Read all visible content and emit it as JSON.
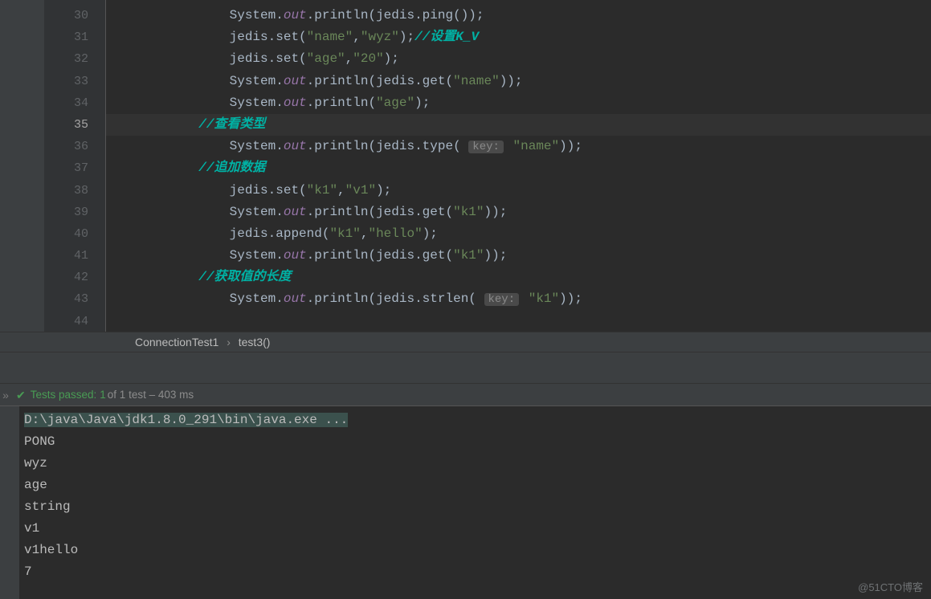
{
  "editor": {
    "lineStart": 30,
    "currentLine": 35,
    "lines": [
      {
        "indent": 16,
        "tokens": [
          {
            "t": "System.",
            "c": "p"
          },
          {
            "t": "out",
            "c": "f"
          },
          {
            "t": ".println(jedis.ping());",
            "c": "p"
          }
        ]
      },
      {
        "indent": 16,
        "tokens": [
          {
            "t": "jedis.set(",
            "c": "p"
          },
          {
            "t": "\"name\"",
            "c": "s"
          },
          {
            "t": ",",
            "c": "p"
          },
          {
            "t": "\"wyz\"",
            "c": "s"
          },
          {
            "t": ");",
            "c": "p"
          },
          {
            "t": "//设置K_V",
            "c": "c"
          }
        ]
      },
      {
        "indent": 16,
        "tokens": [
          {
            "t": "jedis.set(",
            "c": "p"
          },
          {
            "t": "\"age\"",
            "c": "s"
          },
          {
            "t": ",",
            "c": "p"
          },
          {
            "t": "\"20\"",
            "c": "s"
          },
          {
            "t": ");",
            "c": "p"
          }
        ]
      },
      {
        "indent": 16,
        "tokens": [
          {
            "t": "System.",
            "c": "p"
          },
          {
            "t": "out",
            "c": "f"
          },
          {
            "t": ".println(jedis.get(",
            "c": "p"
          },
          {
            "t": "\"name\"",
            "c": "s"
          },
          {
            "t": "));",
            "c": "p"
          }
        ]
      },
      {
        "indent": 16,
        "tokens": [
          {
            "t": "System.",
            "c": "p"
          },
          {
            "t": "out",
            "c": "f"
          },
          {
            "t": ".println(",
            "c": "p"
          },
          {
            "t": "\"age\"",
            "c": "s"
          },
          {
            "t": ");",
            "c": "p"
          }
        ]
      },
      {
        "indent": 12,
        "tokens": [
          {
            "t": "//查看类型",
            "c": "c"
          }
        ]
      },
      {
        "indent": 16,
        "tokens": [
          {
            "t": "System.",
            "c": "p"
          },
          {
            "t": "out",
            "c": "f"
          },
          {
            "t": ".println(jedis.type( ",
            "c": "p"
          },
          {
            "t": "key:",
            "c": "hint"
          },
          {
            "t": " ",
            "c": "p"
          },
          {
            "t": "\"name\"",
            "c": "s"
          },
          {
            "t": "));",
            "c": "p"
          }
        ]
      },
      {
        "indent": 12,
        "tokens": [
          {
            "t": "//追加数据",
            "c": "c"
          }
        ]
      },
      {
        "indent": 16,
        "tokens": [
          {
            "t": "jedis.set(",
            "c": "p"
          },
          {
            "t": "\"k1\"",
            "c": "s"
          },
          {
            "t": ",",
            "c": "p"
          },
          {
            "t": "\"v1\"",
            "c": "s"
          },
          {
            "t": ");",
            "c": "p"
          }
        ]
      },
      {
        "indent": 16,
        "tokens": [
          {
            "t": "System.",
            "c": "p"
          },
          {
            "t": "out",
            "c": "f"
          },
          {
            "t": ".println(jedis.get(",
            "c": "p"
          },
          {
            "t": "\"k1\"",
            "c": "s"
          },
          {
            "t": "));",
            "c": "p"
          }
        ]
      },
      {
        "indent": 16,
        "tokens": [
          {
            "t": "jedis.append(",
            "c": "p"
          },
          {
            "t": "\"k1\"",
            "c": "s"
          },
          {
            "t": ",",
            "c": "p"
          },
          {
            "t": "\"hello\"",
            "c": "s"
          },
          {
            "t": ");",
            "c": "p"
          }
        ]
      },
      {
        "indent": 16,
        "tokens": [
          {
            "t": "System.",
            "c": "p"
          },
          {
            "t": "out",
            "c": "f"
          },
          {
            "t": ".println(jedis.get(",
            "c": "p"
          },
          {
            "t": "\"k1\"",
            "c": "s"
          },
          {
            "t": "));",
            "c": "p"
          }
        ]
      },
      {
        "indent": 12,
        "tokens": [
          {
            "t": "//获取值的长度",
            "c": "c"
          }
        ]
      },
      {
        "indent": 16,
        "tokens": [
          {
            "t": "System.",
            "c": "p"
          },
          {
            "t": "out",
            "c": "f"
          },
          {
            "t": ".println(jedis.strlen( ",
            "c": "p"
          },
          {
            "t": "key:",
            "c": "hint"
          },
          {
            "t": " ",
            "c": "p"
          },
          {
            "t": "\"k1\"",
            "c": "s"
          },
          {
            "t": "));",
            "c": "p"
          }
        ]
      },
      {
        "indent": 0,
        "tokens": []
      }
    ],
    "breadcrumbs": [
      "ConnectionTest1",
      "test3()"
    ]
  },
  "testStatus": {
    "check": "✔",
    "prefix": "Tests passed:",
    "count": "1",
    "suffix": "of 1 test – 403 ms"
  },
  "console": {
    "command": "D:\\java\\Java\\jdk1.8.0_291\\bin\\java.exe ...",
    "output": [
      "PONG",
      "wyz",
      "age",
      "string",
      "v1",
      "v1hello",
      "7"
    ]
  },
  "watermark": "@51CTO博客"
}
